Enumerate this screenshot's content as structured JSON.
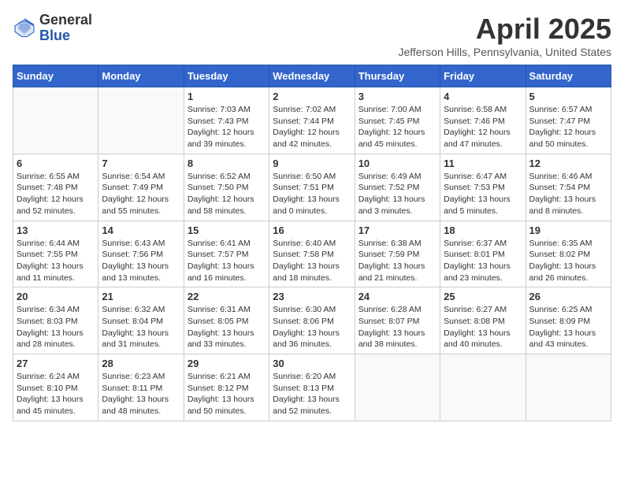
{
  "logo": {
    "general": "General",
    "blue": "Blue"
  },
  "title": "April 2025",
  "location": "Jefferson Hills, Pennsylvania, United States",
  "days_of_week": [
    "Sunday",
    "Monday",
    "Tuesday",
    "Wednesday",
    "Thursday",
    "Friday",
    "Saturday"
  ],
  "weeks": [
    [
      {
        "day": "",
        "info": ""
      },
      {
        "day": "",
        "info": ""
      },
      {
        "day": "1",
        "info": "Sunrise: 7:03 AM\nSunset: 7:43 PM\nDaylight: 12 hours and 39 minutes."
      },
      {
        "day": "2",
        "info": "Sunrise: 7:02 AM\nSunset: 7:44 PM\nDaylight: 12 hours and 42 minutes."
      },
      {
        "day": "3",
        "info": "Sunrise: 7:00 AM\nSunset: 7:45 PM\nDaylight: 12 hours and 45 minutes."
      },
      {
        "day": "4",
        "info": "Sunrise: 6:58 AM\nSunset: 7:46 PM\nDaylight: 12 hours and 47 minutes."
      },
      {
        "day": "5",
        "info": "Sunrise: 6:57 AM\nSunset: 7:47 PM\nDaylight: 12 hours and 50 minutes."
      }
    ],
    [
      {
        "day": "6",
        "info": "Sunrise: 6:55 AM\nSunset: 7:48 PM\nDaylight: 12 hours and 52 minutes."
      },
      {
        "day": "7",
        "info": "Sunrise: 6:54 AM\nSunset: 7:49 PM\nDaylight: 12 hours and 55 minutes."
      },
      {
        "day": "8",
        "info": "Sunrise: 6:52 AM\nSunset: 7:50 PM\nDaylight: 12 hours and 58 minutes."
      },
      {
        "day": "9",
        "info": "Sunrise: 6:50 AM\nSunset: 7:51 PM\nDaylight: 13 hours and 0 minutes."
      },
      {
        "day": "10",
        "info": "Sunrise: 6:49 AM\nSunset: 7:52 PM\nDaylight: 13 hours and 3 minutes."
      },
      {
        "day": "11",
        "info": "Sunrise: 6:47 AM\nSunset: 7:53 PM\nDaylight: 13 hours and 5 minutes."
      },
      {
        "day": "12",
        "info": "Sunrise: 6:46 AM\nSunset: 7:54 PM\nDaylight: 13 hours and 8 minutes."
      }
    ],
    [
      {
        "day": "13",
        "info": "Sunrise: 6:44 AM\nSunset: 7:55 PM\nDaylight: 13 hours and 11 minutes."
      },
      {
        "day": "14",
        "info": "Sunrise: 6:43 AM\nSunset: 7:56 PM\nDaylight: 13 hours and 13 minutes."
      },
      {
        "day": "15",
        "info": "Sunrise: 6:41 AM\nSunset: 7:57 PM\nDaylight: 13 hours and 16 minutes."
      },
      {
        "day": "16",
        "info": "Sunrise: 6:40 AM\nSunset: 7:58 PM\nDaylight: 13 hours and 18 minutes."
      },
      {
        "day": "17",
        "info": "Sunrise: 6:38 AM\nSunset: 7:59 PM\nDaylight: 13 hours and 21 minutes."
      },
      {
        "day": "18",
        "info": "Sunrise: 6:37 AM\nSunset: 8:01 PM\nDaylight: 13 hours and 23 minutes."
      },
      {
        "day": "19",
        "info": "Sunrise: 6:35 AM\nSunset: 8:02 PM\nDaylight: 13 hours and 26 minutes."
      }
    ],
    [
      {
        "day": "20",
        "info": "Sunrise: 6:34 AM\nSunset: 8:03 PM\nDaylight: 13 hours and 28 minutes."
      },
      {
        "day": "21",
        "info": "Sunrise: 6:32 AM\nSunset: 8:04 PM\nDaylight: 13 hours and 31 minutes."
      },
      {
        "day": "22",
        "info": "Sunrise: 6:31 AM\nSunset: 8:05 PM\nDaylight: 13 hours and 33 minutes."
      },
      {
        "day": "23",
        "info": "Sunrise: 6:30 AM\nSunset: 8:06 PM\nDaylight: 13 hours and 36 minutes."
      },
      {
        "day": "24",
        "info": "Sunrise: 6:28 AM\nSunset: 8:07 PM\nDaylight: 13 hours and 38 minutes."
      },
      {
        "day": "25",
        "info": "Sunrise: 6:27 AM\nSunset: 8:08 PM\nDaylight: 13 hours and 40 minutes."
      },
      {
        "day": "26",
        "info": "Sunrise: 6:25 AM\nSunset: 8:09 PM\nDaylight: 13 hours and 43 minutes."
      }
    ],
    [
      {
        "day": "27",
        "info": "Sunrise: 6:24 AM\nSunset: 8:10 PM\nDaylight: 13 hours and 45 minutes."
      },
      {
        "day": "28",
        "info": "Sunrise: 6:23 AM\nSunset: 8:11 PM\nDaylight: 13 hours and 48 minutes."
      },
      {
        "day": "29",
        "info": "Sunrise: 6:21 AM\nSunset: 8:12 PM\nDaylight: 13 hours and 50 minutes."
      },
      {
        "day": "30",
        "info": "Sunrise: 6:20 AM\nSunset: 8:13 PM\nDaylight: 13 hours and 52 minutes."
      },
      {
        "day": "",
        "info": ""
      },
      {
        "day": "",
        "info": ""
      },
      {
        "day": "",
        "info": ""
      }
    ]
  ]
}
